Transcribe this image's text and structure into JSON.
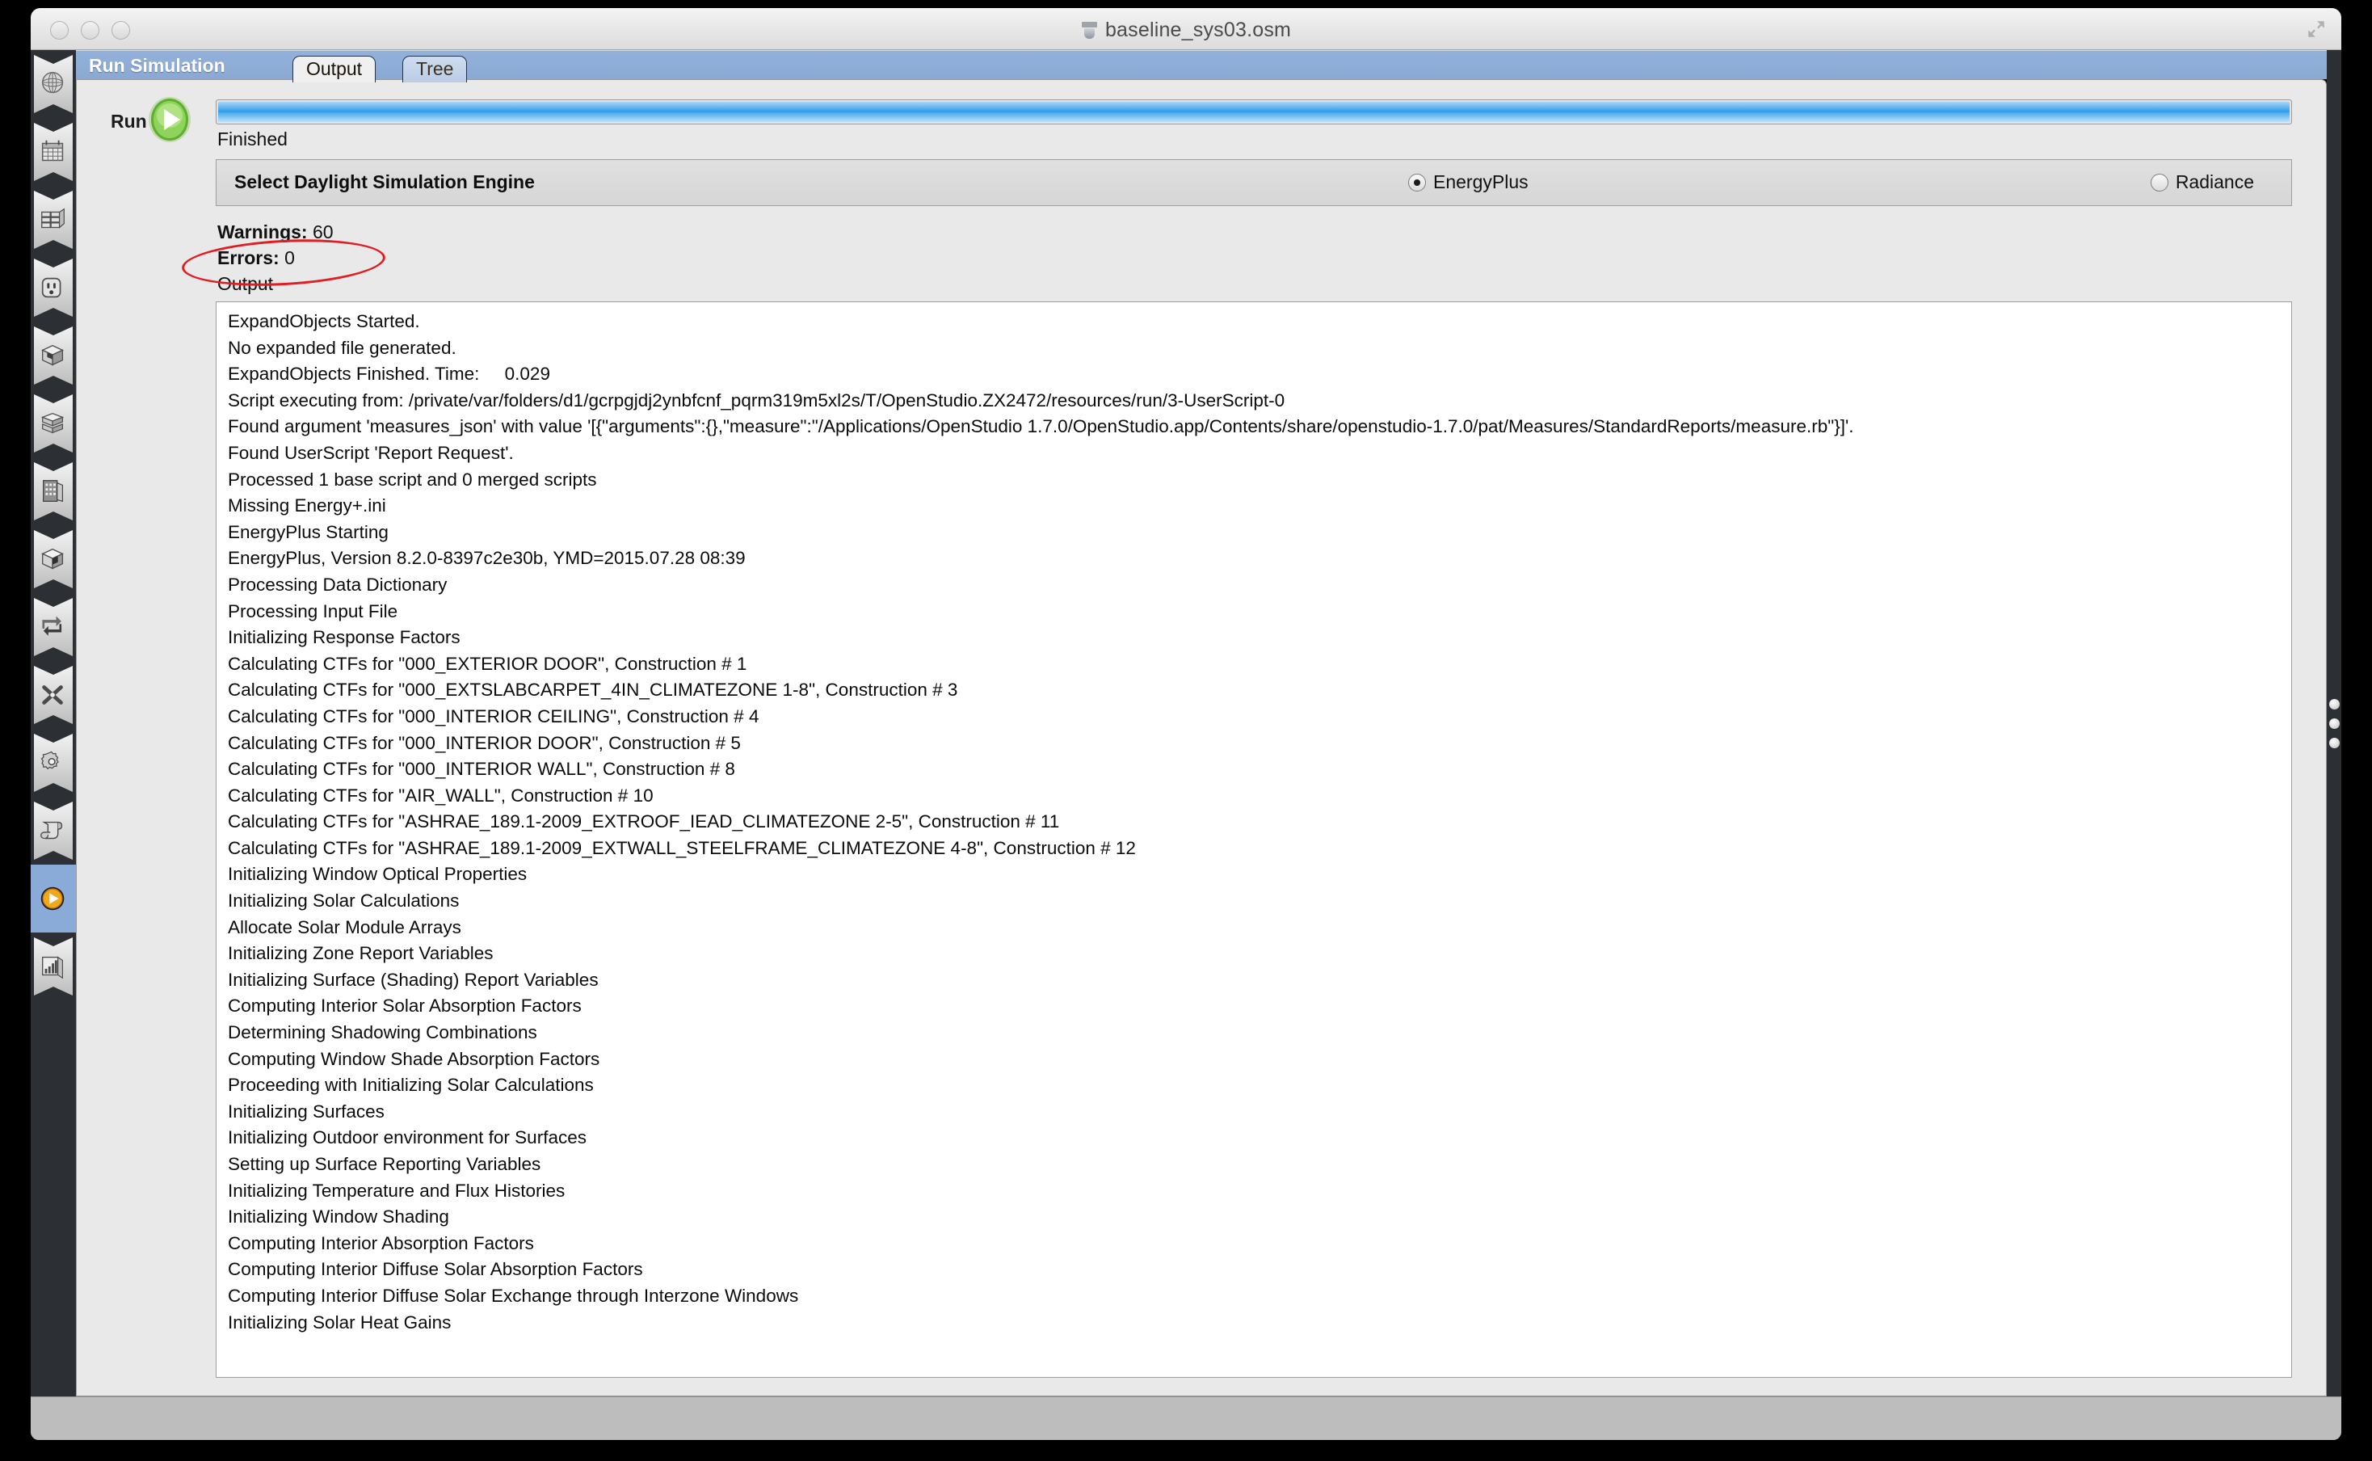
{
  "window": {
    "title": "baseline_sys03.osm",
    "doc_icon": "osm-document-icon",
    "expand_icon": "fullscreen-expand-icon",
    "close_icon": "close-button",
    "minimize_icon": "minimize-button",
    "maximize_icon": "maximize-button"
  },
  "sidebar": {
    "items": [
      {
        "name": "site-icon",
        "label": "Site"
      },
      {
        "name": "schedules-icon",
        "label": "Schedules"
      },
      {
        "name": "constructions-icon",
        "label": "Constructions"
      },
      {
        "name": "loads-icon",
        "label": "Loads"
      },
      {
        "name": "space-types-icon",
        "label": "Space Types"
      },
      {
        "name": "geometry-icon",
        "label": "Geometry"
      },
      {
        "name": "facility-icon",
        "label": "Facility"
      },
      {
        "name": "spaces-icon",
        "label": "Spaces"
      },
      {
        "name": "thermal-zones-icon",
        "label": "Thermal Zones"
      },
      {
        "name": "hvac-systems-icon",
        "label": "HVAC Systems"
      },
      {
        "name": "variables-icon",
        "label": "Output Variables"
      },
      {
        "name": "measures-icon",
        "label": "Measures"
      },
      {
        "name": "run-simulation-icon",
        "label": "Run Simulation"
      },
      {
        "name": "results-icon",
        "label": "Results Summary"
      }
    ],
    "active_index": 12
  },
  "header": {
    "pane_title": "Run Simulation",
    "tabs": [
      {
        "label": "Output",
        "active": true
      },
      {
        "label": "Tree",
        "active": false
      }
    ]
  },
  "run": {
    "label": "Run",
    "button_icon": "play-button",
    "progress_percent": 100,
    "status": "Finished"
  },
  "engine": {
    "label": "Select Daylight Simulation Engine",
    "options": [
      {
        "label": "EnergyPlus",
        "selected": true
      },
      {
        "label": "Radiance",
        "selected": false
      }
    ]
  },
  "summary": {
    "warnings_label": "Warnings:",
    "warnings_count": "60",
    "errors_label": "Errors:",
    "errors_count": "0",
    "output_label": "Output",
    "annotation_color": "#e11d22",
    "annotation_shape": "red-ellipse-highlight"
  },
  "log": {
    "lines": [
      "ExpandObjects Started.",
      "No expanded file generated.",
      "ExpandObjects Finished. Time:     0.029",
      "Script executing from: /private/var/folders/d1/gcrpgjdj2ynbfcnf_pqrm319m5xl2s/T/OpenStudio.ZX2472/resources/run/3-UserScript-0",
      "Found argument 'measures_json' with value '[{\"arguments\":{},\"measure\":\"/Applications/OpenStudio 1.7.0/OpenStudio.app/Contents/share/openstudio-1.7.0/pat/Measures/StandardReports/measure.rb\"}]'.",
      "Found UserScript 'Report Request'.",
      "Processed 1 base script and 0 merged scripts",
      "Missing Energy+.ini",
      "EnergyPlus Starting",
      "EnergyPlus, Version 8.2.0-8397c2e30b, YMD=2015.07.28 08:39",
      "Processing Data Dictionary",
      "Processing Input File",
      "Initializing Response Factors",
      "Calculating CTFs for \"000_EXTERIOR DOOR\", Construction # 1",
      "Calculating CTFs for \"000_EXTSLABCARPET_4IN_CLIMATEZONE 1-8\", Construction # 3",
      "Calculating CTFs for \"000_INTERIOR CEILING\", Construction # 4",
      "Calculating CTFs for \"000_INTERIOR DOOR\", Construction # 5",
      "Calculating CTFs for \"000_INTERIOR WALL\", Construction # 8",
      "Calculating CTFs for \"AIR_WALL\", Construction # 10",
      "Calculating CTFs for \"ASHRAE_189.1-2009_EXTROOF_IEAD_CLIMATEZONE 2-5\", Construction # 11",
      "Calculating CTFs for \"ASHRAE_189.1-2009_EXTWALL_STEELFRAME_CLIMATEZONE 4-8\", Construction # 12",
      "Initializing Window Optical Properties",
      "Initializing Solar Calculations",
      "Allocate Solar Module Arrays",
      "Initializing Zone Report Variables",
      "Initializing Surface (Shading) Report Variables",
      "Computing Interior Solar Absorption Factors",
      "Determining Shadowing Combinations",
      "Computing Window Shade Absorption Factors",
      "Proceeding with Initializing Solar Calculations",
      "Initializing Surfaces",
      "Initializing Outdoor environment for Surfaces",
      "Setting up Surface Reporting Variables",
      "Initializing Temperature and Flux Histories",
      "Initializing Window Shading",
      "Computing Interior Absorption Factors",
      "Computing Interior Diffuse Solar Absorption Factors",
      "Computing Interior Diffuse Solar Exchange through Interzone Windows",
      "Initializing Solar Heat Gains"
    ]
  }
}
